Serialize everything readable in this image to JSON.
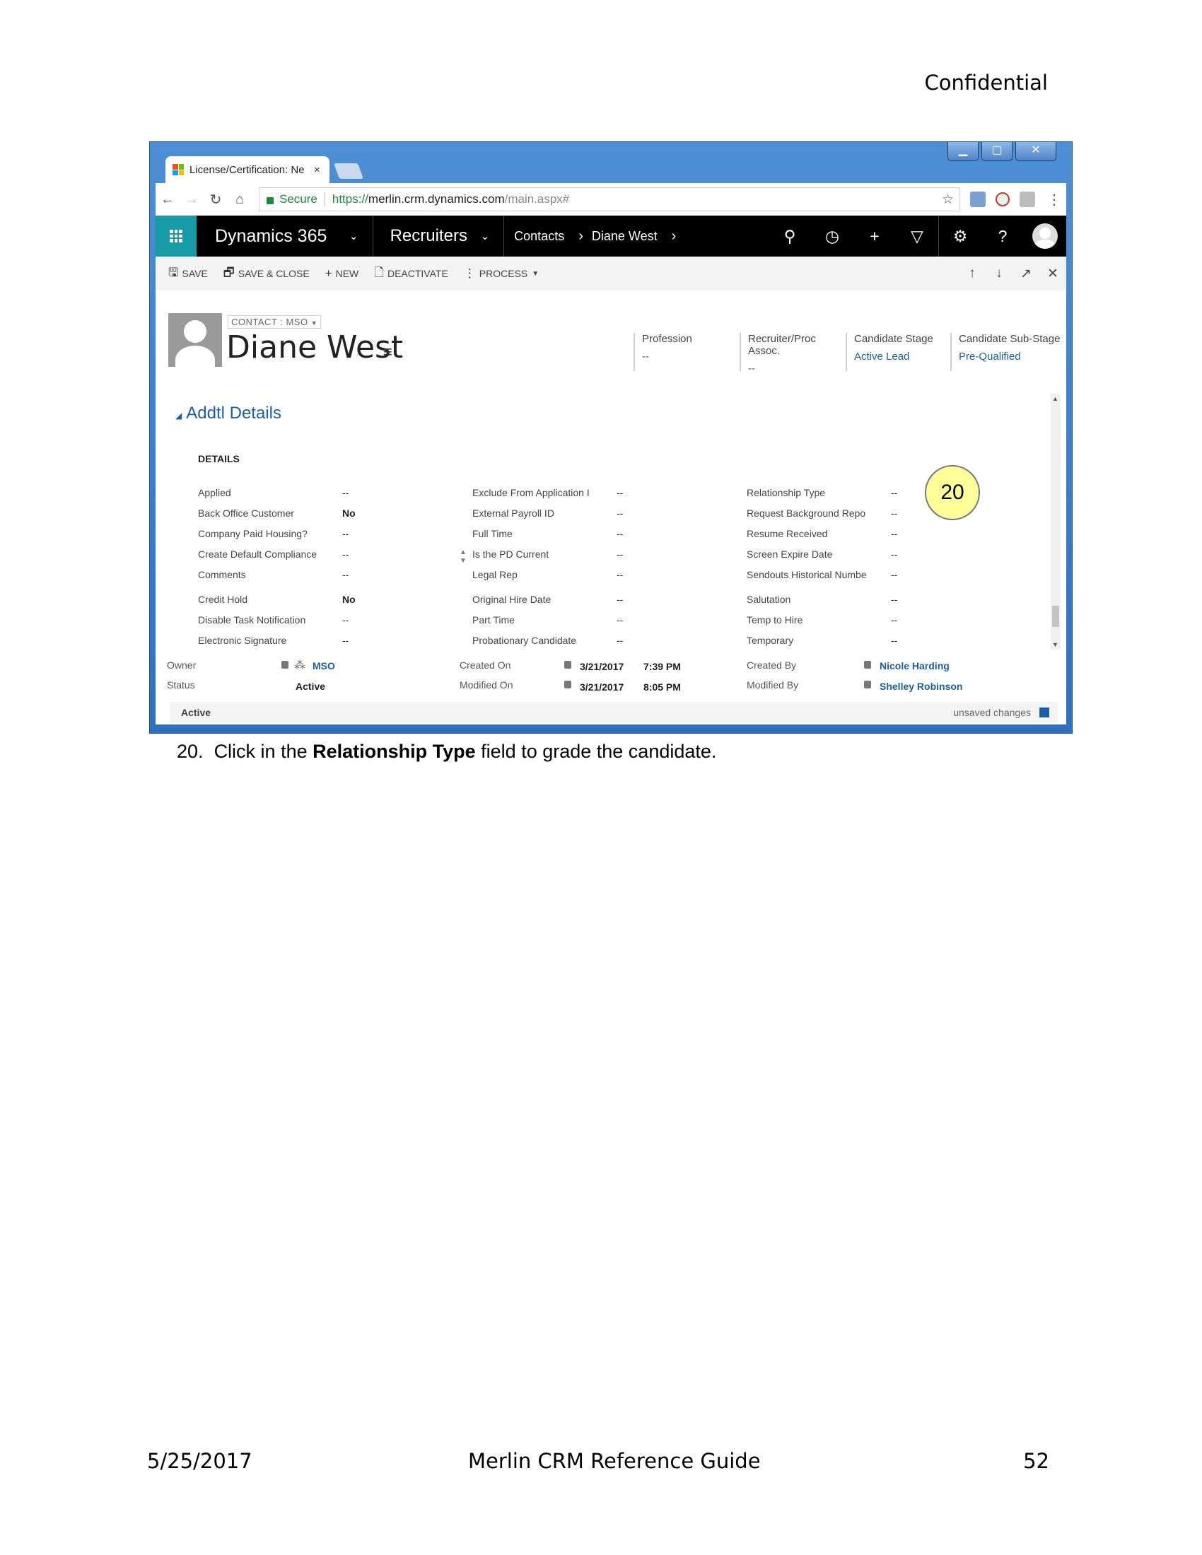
{
  "document": {
    "header": "Confidential",
    "caption_number": "20.",
    "caption_pre": "Click in the ",
    "caption_bold": "Relationship Type",
    "caption_post": " field to grade the candidate.",
    "footer_date": "5/25/2017",
    "footer_title": "Merlin CRM Reference Guide",
    "footer_page": "52",
    "callout": "20"
  },
  "browser": {
    "tab_title": "License/Certification: Ne",
    "tab_close": "×",
    "secure_label": "Secure",
    "url_scheme": "https://",
    "url_host": "merlin.crm.dynamics.com",
    "url_path": "/main.aspx#",
    "window_min": "▁",
    "window_max": "▢",
    "window_close": "✕"
  },
  "nav": {
    "brand": "Dynamics 365",
    "module": "Recruiters",
    "crumbs": [
      "Contacts",
      "Diane West"
    ]
  },
  "toolbar": {
    "save": "SAVE",
    "save_close": "SAVE & CLOSE",
    "new": "NEW",
    "deactivate": "DEACTIVATE",
    "process": "PROCESS"
  },
  "record": {
    "form_selector": "CONTACT : MSO",
    "name": "Diane West",
    "header_fields": [
      {
        "label": "Profession",
        "value": "--"
      },
      {
        "label": "Recruiter/Proc Assoc.",
        "value": "--"
      },
      {
        "label": "Candidate Stage",
        "value": "Active Lead"
      },
      {
        "label": "Candidate Sub-Stage",
        "value": "Pre-Qualified"
      }
    ]
  },
  "section": {
    "title": "Addtl Details",
    "subsection": "DETAILS",
    "col1": [
      {
        "label": "Applied",
        "value": "--"
      },
      {
        "label": "Back Office Customer",
        "value": "No"
      },
      {
        "label": "Company Paid Housing?",
        "value": "--"
      },
      {
        "label": "Create Default Compliance",
        "value": "--"
      },
      {
        "label": "Comments",
        "value": "--"
      },
      {
        "label": "Credit Hold",
        "value": "No"
      },
      {
        "label": "Disable Task Notification",
        "value": "--"
      },
      {
        "label": "Electronic Signature",
        "value": "--"
      }
    ],
    "col2": [
      {
        "label": "Exclude From Application I",
        "value": "--"
      },
      {
        "label": "External Payroll ID",
        "value": "--"
      },
      {
        "label": "Full Time",
        "value": "--"
      },
      {
        "label": "Is the PD Current",
        "value": "--"
      },
      {
        "label": "Legal Rep",
        "value": "--"
      },
      {
        "label": "Original Hire Date",
        "value": "--"
      },
      {
        "label": "Part Time",
        "value": "--"
      },
      {
        "label": "Probationary Candidate",
        "value": "--"
      }
    ],
    "col3": [
      {
        "label": "Relationship Type",
        "value": "--"
      },
      {
        "label": "Request Background Repo",
        "value": "--"
      },
      {
        "label": "Resume Received",
        "value": "--"
      },
      {
        "label": "Screen Expire Date",
        "value": "--"
      },
      {
        "label": "Sendouts Historical Numbe",
        "value": "--"
      },
      {
        "label": "Salutation",
        "value": "--"
      },
      {
        "label": "Temp to Hire",
        "value": "--"
      },
      {
        "label": "Temporary",
        "value": "--"
      }
    ]
  },
  "footer_fields": {
    "owner_label": "Owner",
    "owner_value": "MSO",
    "status_label": "Status",
    "status_value": "Active",
    "created_on_label": "Created On",
    "created_on_date": "3/21/2017",
    "created_on_time": "7:39 PM",
    "modified_on_label": "Modified On",
    "modified_on_date": "3/21/2017",
    "modified_on_time": "8:05 PM",
    "created_by_label": "Created By",
    "created_by_value": "Nicole Harding",
    "modified_by_label": "Modified By",
    "modified_by_value": "Shelley Robinson"
  },
  "statusbar": {
    "state": "Active",
    "unsaved": "unsaved changes"
  },
  "colors": {
    "accent": "#1b5fa8",
    "waffle": "#159ca6",
    "callout_fill": "#ffff99"
  }
}
